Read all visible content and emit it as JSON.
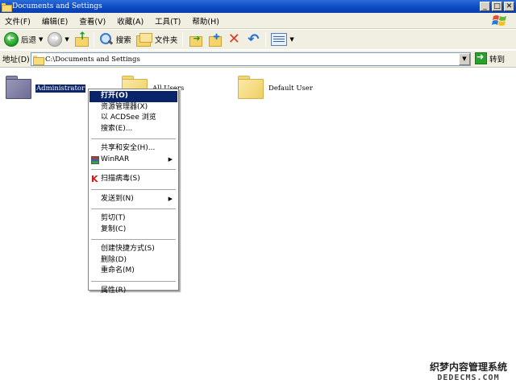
{
  "window": {
    "title": "Documents and Settings",
    "controls": [
      "_",
      "□",
      "✕"
    ]
  },
  "menubar": [
    "文件(F)",
    "编辑(E)",
    "查看(V)",
    "收藏(A)",
    "工具(T)",
    "帮助(H)"
  ],
  "toolbar": {
    "back_label": "后退",
    "search_label": "搜索",
    "folders_label": "文件夹"
  },
  "address": {
    "label": "地址(D)",
    "value": "C:\\Documents and Settings",
    "go_label": "转到"
  },
  "folders": [
    {
      "name": "Administrator",
      "selected": true
    },
    {
      "name": "All Users",
      "selected": false
    },
    {
      "name": "Default User",
      "selected": false
    }
  ],
  "context_menu": {
    "groups": [
      [
        {
          "label": "打开(O)"
        },
        {
          "label": "资源管理器(X)"
        },
        {
          "label": "以 ACDSee 浏览"
        },
        {
          "label": "搜索(E)..."
        }
      ],
      [
        {
          "label": "共享和安全(H)..."
        },
        {
          "label": "WinRAR"
        }
      ],
      [
        {
          "label": "扫描病毒(S)"
        }
      ],
      [
        {
          "label": "发送到(N)"
        }
      ],
      [
        {
          "label": "剪切(T)"
        },
        {
          "label": "复制(C)"
        }
      ],
      [
        {
          "label": "创建快捷方式(S)"
        },
        {
          "label": "删除(D)"
        },
        {
          "label": "重命名(M)"
        }
      ],
      [
        {
          "label": "属性(R)"
        }
      ]
    ]
  },
  "watermark": {
    "text": "织梦内容管理系统",
    "url": "DEDECMS.COM"
  }
}
